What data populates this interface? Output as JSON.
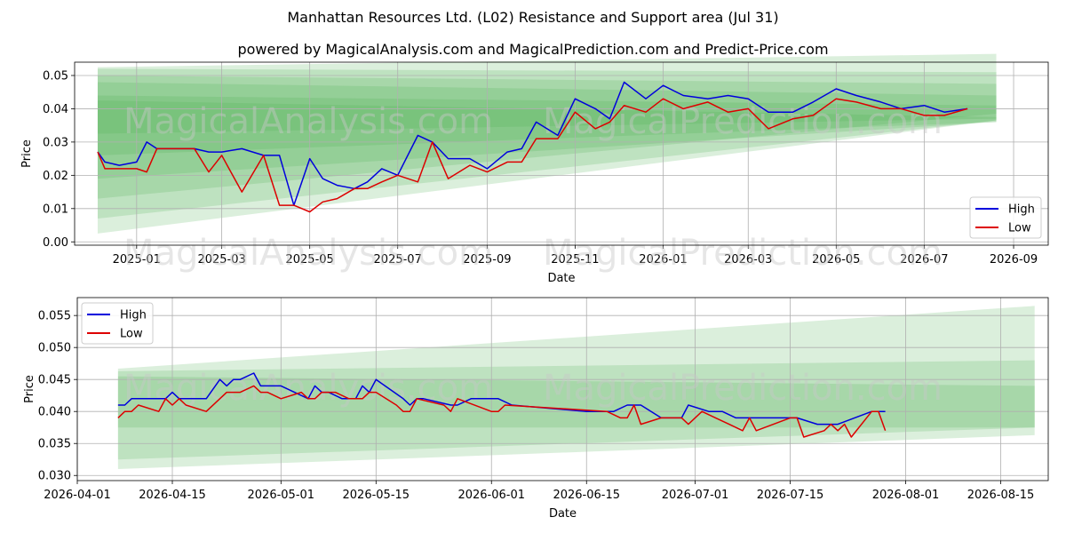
{
  "title": "Manhattan Resources Ltd. (L02) Resistance and Support area (Jul 31)",
  "subtitle": "powered by MagicalAnalysis.com and MagicalPrediction.com and Predict-Price.com",
  "watermarks": [
    "MagicalAnalysis.com",
    "MagicalPrediction.com"
  ],
  "colors": {
    "high": "#0000dd",
    "low": "#dd0000",
    "band": "#4caf50",
    "grid": "#b0b0b0"
  },
  "chart_data": [
    {
      "type": "line",
      "xlabel": "Date",
      "ylabel": "Price",
      "ylim": [
        -0.001,
        0.054
      ],
      "xlim": [
        "2024-11-19",
        "2026-09-25"
      ],
      "grid": true,
      "legend": "lower-right",
      "x_ticks": [
        "2025-01",
        "2025-03",
        "2025-05",
        "2025-07",
        "2025-09",
        "2025-11",
        "2026-01",
        "2026-03",
        "2026-05",
        "2026-07",
        "2026-09"
      ],
      "y_ticks": [
        "0.00",
        "0.01",
        "0.02",
        "0.03",
        "0.04",
        "0.05"
      ],
      "series": [
        {
          "name": "High",
          "x": [
            "2024-12-05",
            "2024-12-10",
            "2024-12-20",
            "2025-01-01",
            "2025-01-08",
            "2025-01-15",
            "2025-02-10",
            "2025-02-20",
            "2025-03-01",
            "2025-03-15",
            "2025-03-30",
            "2025-04-10",
            "2025-04-20",
            "2025-05-01",
            "2025-05-10",
            "2025-05-20",
            "2025-06-01",
            "2025-06-10",
            "2025-06-20",
            "2025-07-01",
            "2025-07-15",
            "2025-07-25",
            "2025-08-05",
            "2025-08-20",
            "2025-09-01",
            "2025-09-15",
            "2025-09-25",
            "2025-10-05",
            "2025-10-20",
            "2025-11-01",
            "2025-11-15",
            "2025-11-25",
            "2025-12-05",
            "2025-12-20",
            "2026-01-01",
            "2026-01-15",
            "2026-02-01",
            "2026-02-15",
            "2026-03-01",
            "2026-03-15",
            "2026-04-01",
            "2026-04-15",
            "2026-05-01",
            "2026-05-15",
            "2026-06-01",
            "2026-06-15",
            "2026-07-01",
            "2026-07-15",
            "2026-07-31"
          ],
          "values": [
            0.027,
            0.024,
            0.023,
            0.024,
            0.03,
            0.028,
            0.028,
            0.027,
            0.027,
            0.028,
            0.026,
            0.026,
            0.011,
            0.025,
            0.019,
            0.017,
            0.016,
            0.018,
            0.022,
            0.02,
            0.032,
            0.03,
            0.025,
            0.025,
            0.022,
            0.027,
            0.028,
            0.036,
            0.032,
            0.043,
            0.04,
            0.037,
            0.048,
            0.043,
            0.047,
            0.044,
            0.043,
            0.044,
            0.043,
            0.039,
            0.039,
            0.042,
            0.046,
            0.044,
            0.042,
            0.04,
            0.041,
            0.039,
            0.04
          ]
        },
        {
          "name": "Low",
          "x": [
            "2024-12-05",
            "2024-12-10",
            "2024-12-20",
            "2025-01-01",
            "2025-01-08",
            "2025-01-15",
            "2025-02-10",
            "2025-02-20",
            "2025-03-01",
            "2025-03-15",
            "2025-03-30",
            "2025-04-10",
            "2025-04-20",
            "2025-05-01",
            "2025-05-10",
            "2025-05-20",
            "2025-06-01",
            "2025-06-10",
            "2025-06-20",
            "2025-07-01",
            "2025-07-15",
            "2025-07-25",
            "2025-08-05",
            "2025-08-20",
            "2025-09-01",
            "2025-09-15",
            "2025-09-25",
            "2025-10-05",
            "2025-10-20",
            "2025-11-01",
            "2025-11-15",
            "2025-11-25",
            "2025-12-05",
            "2025-12-20",
            "2026-01-01",
            "2026-01-15",
            "2026-02-01",
            "2026-02-15",
            "2026-03-01",
            "2026-03-15",
            "2026-04-01",
            "2026-04-15",
            "2026-05-01",
            "2026-05-15",
            "2026-06-01",
            "2026-06-15",
            "2026-07-01",
            "2026-07-15",
            "2026-07-31"
          ],
          "values": [
            0.027,
            0.022,
            0.022,
            0.022,
            0.021,
            0.028,
            0.028,
            0.021,
            0.026,
            0.015,
            0.026,
            0.011,
            0.011,
            0.009,
            0.012,
            0.013,
            0.016,
            0.016,
            0.018,
            0.02,
            0.018,
            0.03,
            0.019,
            0.023,
            0.021,
            0.024,
            0.024,
            0.031,
            0.031,
            0.039,
            0.034,
            0.036,
            0.041,
            0.039,
            0.043,
            0.04,
            0.042,
            0.039,
            0.04,
            0.034,
            0.037,
            0.038,
            0.043,
            0.042,
            0.04,
            0.04,
            0.038,
            0.038,
            0.04
          ]
        }
      ]
    },
    {
      "type": "line",
      "xlabel": "Date",
      "ylabel": "Price",
      "ylim": [
        0.0292,
        0.0578
      ],
      "xlim": [
        "2026-04-01",
        "2026-08-22"
      ],
      "grid": true,
      "legend": "top-left",
      "x_ticks": [
        "2026-04-01",
        "2026-04-15",
        "2026-05-01",
        "2026-05-15",
        "2026-06-01",
        "2026-06-15",
        "2026-07-01",
        "2026-07-15",
        "2026-08-01",
        "2026-08-15"
      ],
      "y_ticks": [
        "0.030",
        "0.035",
        "0.040",
        "0.045",
        "0.050",
        "0.055"
      ],
      "series": [
        {
          "name": "High",
          "x": [
            "2026-04-07",
            "2026-04-08",
            "2026-04-09",
            "2026-04-10",
            "2026-04-12",
            "2026-04-14",
            "2026-04-15",
            "2026-04-16",
            "2026-04-17",
            "2026-04-20",
            "2026-04-22",
            "2026-04-23",
            "2026-04-24",
            "2026-04-25",
            "2026-04-27",
            "2026-04-28",
            "2026-04-29",
            "2026-05-01",
            "2026-05-05",
            "2026-05-06",
            "2026-05-07",
            "2026-05-08",
            "2026-05-10",
            "2026-05-12",
            "2026-05-13",
            "2026-05-14",
            "2026-05-15",
            "2026-05-19",
            "2026-05-20",
            "2026-05-21",
            "2026-05-22",
            "2026-05-26",
            "2026-05-27",
            "2026-05-29",
            "2026-06-02",
            "2026-06-04",
            "2026-06-15",
            "2026-06-17",
            "2026-06-19",
            "2026-06-21",
            "2026-06-22",
            "2026-06-23",
            "2026-06-26",
            "2026-06-28",
            "2026-06-29",
            "2026-06-30",
            "2026-07-03",
            "2026-07-05",
            "2026-07-07",
            "2026-07-10",
            "2026-07-16",
            "2026-07-19",
            "2026-07-21",
            "2026-07-22",
            "2026-07-27",
            "2026-07-29"
          ],
          "values": [
            0.041,
            0.041,
            0.042,
            0.042,
            0.042,
            0.042,
            0.043,
            0.042,
            0.042,
            0.042,
            0.045,
            0.044,
            0.045,
            0.045,
            0.046,
            0.044,
            0.044,
            0.044,
            0.042,
            0.044,
            0.043,
            0.043,
            0.042,
            0.042,
            0.044,
            0.043,
            0.045,
            0.042,
            0.041,
            0.042,
            0.042,
            0.041,
            0.041,
            0.042,
            0.042,
            0.041,
            0.04,
            0.04,
            0.04,
            0.041,
            0.041,
            0.041,
            0.039,
            0.039,
            0.039,
            0.041,
            0.04,
            0.04,
            0.039,
            0.039,
            0.039,
            0.038,
            0.038,
            0.038,
            0.04,
            0.04
          ]
        },
        {
          "name": "Low",
          "x": [
            "2026-04-07",
            "2026-04-08",
            "2026-04-09",
            "2026-04-10",
            "2026-04-13",
            "2026-04-14",
            "2026-04-15",
            "2026-04-16",
            "2026-04-17",
            "2026-04-20",
            "2026-04-22",
            "2026-04-23",
            "2026-04-24",
            "2026-04-25",
            "2026-04-27",
            "2026-04-28",
            "2026-04-29",
            "2026-05-01",
            "2026-05-04",
            "2026-05-05",
            "2026-05-06",
            "2026-05-07",
            "2026-05-09",
            "2026-05-11",
            "2026-05-12",
            "2026-05-13",
            "2026-05-14",
            "2026-05-15",
            "2026-05-18",
            "2026-05-19",
            "2026-05-20",
            "2026-05-21",
            "2026-05-25",
            "2026-05-26",
            "2026-05-27",
            "2026-06-01",
            "2026-06-02",
            "2026-06-03",
            "2026-06-18",
            "2026-06-20",
            "2026-06-21",
            "2026-06-22",
            "2026-06-23",
            "2026-06-26",
            "2026-06-28",
            "2026-06-29",
            "2026-06-30",
            "2026-07-02",
            "2026-07-04",
            "2026-07-06",
            "2026-07-08",
            "2026-07-09",
            "2026-07-10",
            "2026-07-15",
            "2026-07-16",
            "2026-07-17",
            "2026-07-20",
            "2026-07-21",
            "2026-07-22",
            "2026-07-23",
            "2026-07-24",
            "2026-07-27",
            "2026-07-28",
            "2026-07-29"
          ],
          "values": [
            0.039,
            0.04,
            0.04,
            0.041,
            0.04,
            0.042,
            0.041,
            0.042,
            0.041,
            0.04,
            0.042,
            0.043,
            0.043,
            0.043,
            0.044,
            0.043,
            0.043,
            0.042,
            0.043,
            0.042,
            0.042,
            0.043,
            0.043,
            0.042,
            0.042,
            0.042,
            0.043,
            0.043,
            0.041,
            0.04,
            0.04,
            0.042,
            0.041,
            0.04,
            0.042,
            0.04,
            0.04,
            0.041,
            0.04,
            0.039,
            0.039,
            0.041,
            0.038,
            0.039,
            0.039,
            0.039,
            0.038,
            0.04,
            0.039,
            0.038,
            0.037,
            0.039,
            0.037,
            0.039,
            0.039,
            0.036,
            0.037,
            0.038,
            0.037,
            0.038,
            0.036,
            0.04,
            0.04,
            0.037
          ]
        }
      ]
    }
  ],
  "bands": [
    {
      "name": "band-1",
      "top_start": 0.0425,
      "top_end": 0.0375,
      "bottom_start": 0.0325,
      "bottom_end": 0.037
    },
    {
      "name": "band-2",
      "top_start": 0.044,
      "top_end": 0.041,
      "bottom_start": 0.026,
      "bottom_end": 0.036
    },
    {
      "name": "band-3",
      "top_start": 0.048,
      "top_end": 0.044,
      "bottom_start": 0.019,
      "bottom_end": 0.036
    },
    {
      "name": "band-4",
      "top_start": 0.05,
      "top_end": 0.0475,
      "bottom_start": 0.013,
      "bottom_end": 0.0385
    },
    {
      "name": "band-5",
      "top_start": 0.052,
      "top_end": 0.051,
      "bottom_start": 0.007,
      "bottom_end": 0.0365
    },
    {
      "name": "band-6",
      "top_start": 0.0525,
      "top_end": 0.0565,
      "bottom_start": 0.0025,
      "bottom_end": 0.0365
    }
  ],
  "bands_zoom": [
    {
      "name": "zband-1",
      "top_start": 0.0455,
      "top_end": 0.044,
      "bottom_start": 0.0375,
      "bottom_end": 0.0375
    },
    {
      "name": "zband-2",
      "top_start": 0.0463,
      "top_end": 0.048,
      "bottom_start": 0.0325,
      "bottom_end": 0.0375
    },
    {
      "name": "zband-3",
      "top_start": 0.0467,
      "top_end": 0.0565,
      "bottom_start": 0.031,
      "bottom_end": 0.0363
    }
  ]
}
